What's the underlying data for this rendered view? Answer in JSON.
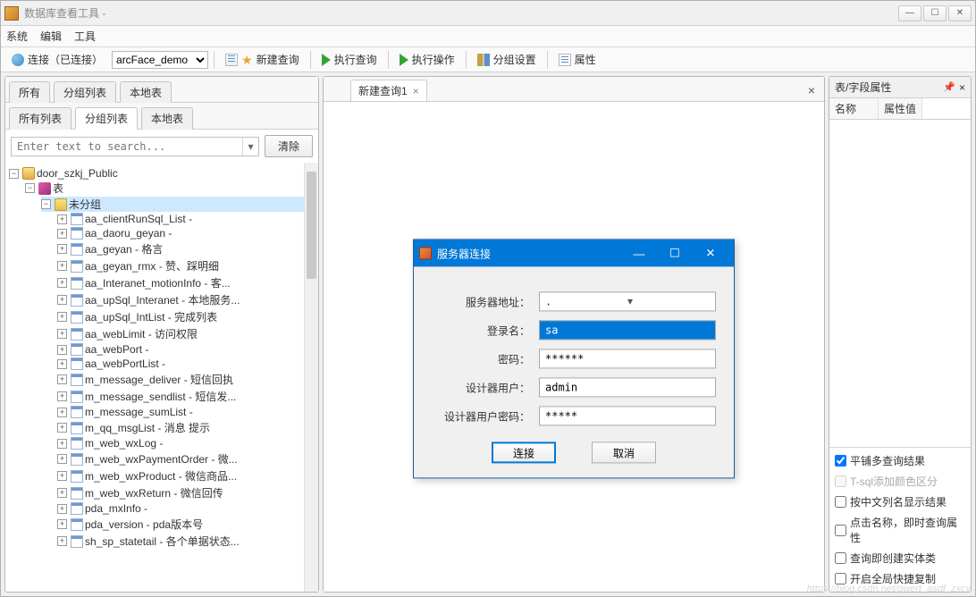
{
  "titlebar": {
    "title": "数据库查看工具 - "
  },
  "menubar": {
    "items": [
      "系统",
      "编辑",
      "工具"
    ]
  },
  "toolbar": {
    "connect_label": "连接（已连接）",
    "database_selected": "arcFace_demo",
    "new_query": "新建查询",
    "exec_query": "执行查询",
    "exec_op": "执行操作",
    "group_set": "分组设置",
    "props": "属性"
  },
  "left": {
    "top_tabs": [
      "所有",
      "分组列表",
      "本地表"
    ],
    "sub_tabs": [
      "所有列表",
      "分组列表",
      "本地表"
    ],
    "active_sub_tab": 1,
    "search_placeholder": "Enter text to search...",
    "clear_label": "清除",
    "tree": {
      "root": "door_szkj_Public",
      "tables_label": "表",
      "group_label": "未分组",
      "items": [
        "aa_clientRunSql_List - ",
        "aa_daoru_geyan - ",
        "aa_geyan - 格言",
        "aa_geyan_rmx - 赞、踩明细",
        "aa_Interanet_motionInfo - 客...",
        "aa_upSql_Interanet - 本地服务...",
        "aa_upSql_IntList - 完成列表",
        "aa_webLimit - 访问权限",
        "aa_webPort - ",
        "aa_webPortList - ",
        "m_message_deliver - 短信回执",
        "m_message_sendlist - 短信发...",
        "m_message_sumList - ",
        "m_qq_msgList - 消息 提示",
        "m_web_wxLog - ",
        "m_web_wxPaymentOrder - 微...",
        "m_web_wxProduct - 微信商品...",
        "m_web_wxReturn - 微信回传",
        "pda_mxInfo - ",
        "pda_version - pda版本号",
        "sh_sp_statetail - 各个单据状态..."
      ]
    }
  },
  "center": {
    "tab_label": "新建查询1",
    "dialog": {
      "title": "服务器连接",
      "server_label": "服务器地址：",
      "server_value": ".",
      "login_label": "登录名：",
      "login_value": "sa",
      "pwd_label": "密码：",
      "pwd_value": "******",
      "designer_user_label": "设计器用户：",
      "designer_user_value": "admin",
      "designer_pwd_label": "设计器用户密码：",
      "designer_pwd_value": "*****",
      "connect_btn": "连接",
      "cancel_btn": "取消"
    }
  },
  "right": {
    "title": "表/字段属性",
    "col_name": "名称",
    "col_val": "属性值",
    "checks": [
      {
        "label": "平铺多查询结果",
        "checked": true,
        "disabled": false
      },
      {
        "label": "T-sql添加颜色区分",
        "checked": false,
        "disabled": true
      },
      {
        "label": "按中文列名显示结果",
        "checked": false,
        "disabled": false
      },
      {
        "label": "点击名称，即时查询属性",
        "checked": false,
        "disabled": false
      },
      {
        "label": "查询即创建实体类",
        "checked": false,
        "disabled": false
      },
      {
        "label": "开启全局快捷复制",
        "checked": false,
        "disabled": false
      }
    ]
  },
  "watermark": "https://blog.csdn.net/qwert_asdf_zxcv"
}
